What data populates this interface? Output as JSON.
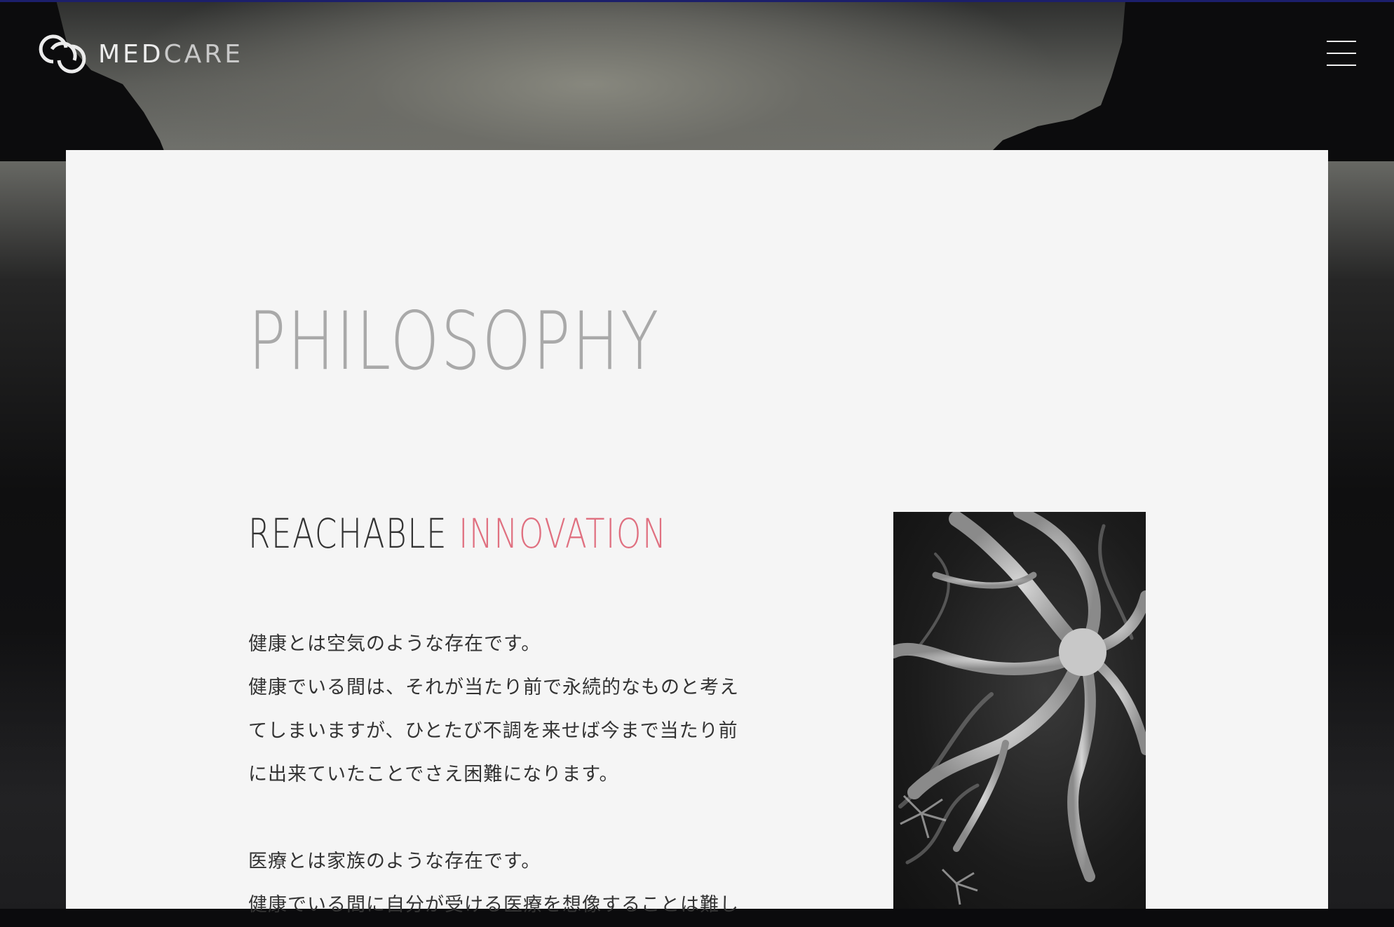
{
  "header": {
    "logo_text_bright": "MED",
    "logo_text_dim": "CARE",
    "menu_icon": "hamburger-menu-icon"
  },
  "main": {
    "title": "PHILOSOPHY",
    "subtitle_part1": "REACHABLE",
    "subtitle_part2": "INNOVATION",
    "paragraphs": [
      "健康とは空気のような存在です。",
      "健康でいる間は、それが当たり前で永続的なものと考え",
      "てしまいますが、ひとたび不調を来せば今まで当たり前",
      "に出来ていたことでさえ困難になります。",
      "医療とは家族のような存在です。",
      "健康でいる間に自分が受ける医療を想像することは難し"
    ]
  },
  "colors": {
    "accent": "#e07080",
    "card_background": "#f5f5f5",
    "title_gray": "#a9a9a9"
  }
}
